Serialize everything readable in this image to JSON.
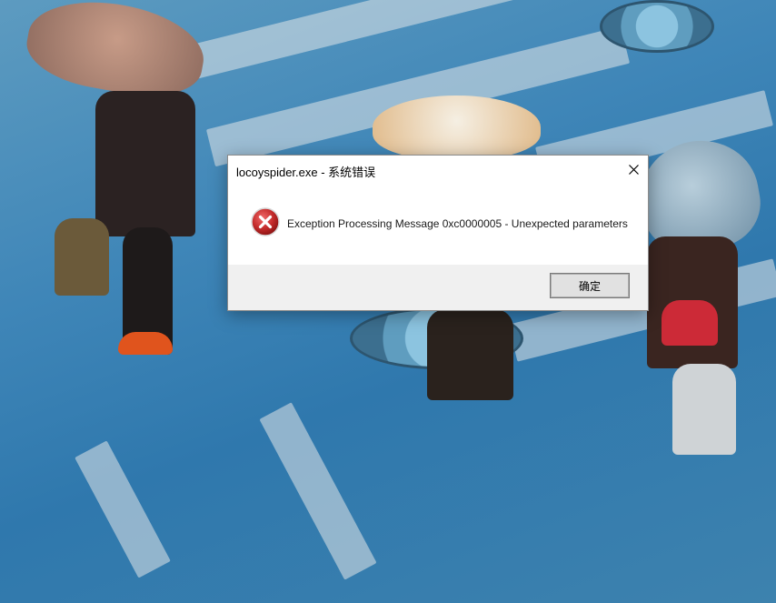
{
  "dialog": {
    "title": "locoyspider.exe - 系统错误",
    "close_icon": "close-icon",
    "message": "Exception Processing Message 0xc0000005 - Unexpected parameters",
    "icon": "error-icon",
    "ok_label": "确定"
  },
  "colors": {
    "error_red": "#c42b2b",
    "footer_bg": "#f0f0f0",
    "button_bg": "#e1e1e1"
  }
}
